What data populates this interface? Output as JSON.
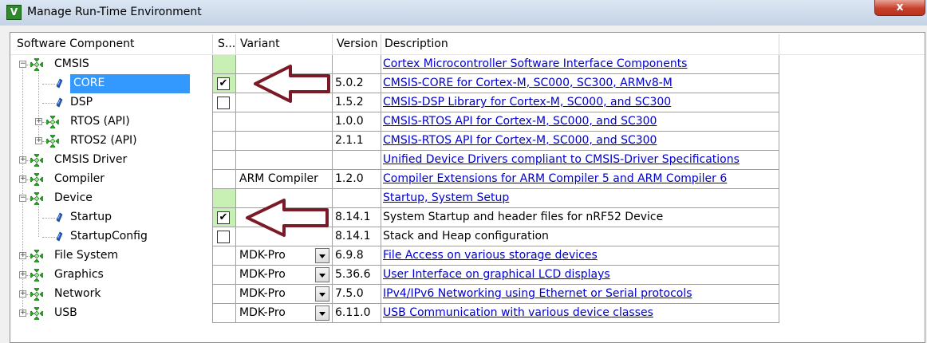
{
  "window": {
    "title": "Manage Run-Time Environment",
    "close_glyph": "x",
    "icon": "keil-app-icon"
  },
  "columns": {
    "component": "Software Component",
    "sel": "S...",
    "variant": "Variant",
    "version": "Version",
    "description": "Description"
  },
  "rows": [
    {
      "name": "CMSIS",
      "level": 0,
      "node": "expanded",
      "icon": "component-group-icon",
      "sel": "none",
      "sel_green": true,
      "variant": "",
      "version": "",
      "description": "Cortex Microcontroller Software Interface Components",
      "link": true
    },
    {
      "name": "CORE",
      "level": 1,
      "node": "leaf",
      "icon": "component-leaf-icon",
      "selected": true,
      "sel": "checked",
      "sel_green": true,
      "variant": "",
      "version": "5.0.2",
      "description": "CMSIS-CORE for Cortex-M, SC000, SC300, ARMv8-M",
      "link": true
    },
    {
      "name": "DSP",
      "level": 1,
      "node": "leaf",
      "icon": "component-leaf-icon",
      "sel": "unchecked",
      "variant": "",
      "version": "1.5.2",
      "description": "CMSIS-DSP Library for Cortex-M, SC000, and SC300",
      "link": true
    },
    {
      "name": "RTOS (API)",
      "level": 1,
      "node": "collapsed",
      "icon": "component-group-icon",
      "sel": "none",
      "variant": "",
      "version": "1.0.0",
      "description": "CMSIS-RTOS API for Cortex-M, SC000, and SC300",
      "link": true
    },
    {
      "name": "RTOS2 (API)",
      "level": 1,
      "node": "collapsed",
      "icon": "component-group-icon",
      "sel": "none",
      "variant": "",
      "version": "2.1.1",
      "description": "CMSIS-RTOS API for Cortex-M, SC000, and SC300",
      "link": true
    },
    {
      "name": "CMSIS Driver",
      "level": 0,
      "node": "collapsed",
      "icon": "component-group-icon",
      "sel": "none",
      "variant": "",
      "version": "",
      "description": "Unified Device Drivers compliant to CMSIS-Driver Specifications",
      "link": true
    },
    {
      "name": "Compiler",
      "level": 0,
      "node": "collapsed",
      "icon": "component-group-icon",
      "sel": "none",
      "variant": "ARM Compiler",
      "version": "1.2.0",
      "description": "Compiler Extensions for ARM Compiler 5 and ARM Compiler 6",
      "link": true
    },
    {
      "name": "Device",
      "level": 0,
      "node": "expanded",
      "icon": "component-group-icon",
      "sel": "none",
      "sel_green": true,
      "variant": "",
      "version": "",
      "description": "Startup, System Setup",
      "link": true
    },
    {
      "name": "Startup",
      "level": 1,
      "node": "leaf",
      "icon": "component-leaf-icon",
      "sel": "checked",
      "sel_green": true,
      "variant": "",
      "version": "8.14.1",
      "description": "System Startup and header files for nRF52 Device",
      "link": false
    },
    {
      "name": "StartupConfig",
      "level": 1,
      "node": "leaf",
      "icon": "component-leaf-icon",
      "sel": "unchecked",
      "variant": "",
      "version": "8.14.1",
      "description": "Stack and Heap configuration",
      "link": false
    },
    {
      "name": "File System",
      "level": 0,
      "node": "collapsed",
      "icon": "component-group-icon",
      "sel": "none",
      "variant": "MDK-Pro",
      "dropdown": true,
      "version": "6.9.8",
      "description": "File Access on various storage devices",
      "link": true
    },
    {
      "name": "Graphics",
      "level": 0,
      "node": "collapsed",
      "icon": "component-group-icon",
      "sel": "none",
      "variant": "MDK-Pro",
      "dropdown": true,
      "version": "5.36.6",
      "description": "User Interface on graphical LCD displays",
      "link": true
    },
    {
      "name": "Network",
      "level": 0,
      "node": "collapsed",
      "icon": "component-group-icon",
      "sel": "none",
      "variant": "MDK-Pro",
      "dropdown": true,
      "version": "7.5.0",
      "description": "IPv4/IPv6 Networking using Ethernet or Serial protocols",
      "link": true
    },
    {
      "name": "USB",
      "level": 0,
      "node": "collapsed",
      "icon": "component-group-icon",
      "sel": "none",
      "variant": "MDK-Pro",
      "dropdown": true,
      "version": "6.11.0",
      "description": "USB Communication with various device classes",
      "link": true
    }
  ],
  "annotations": [
    {
      "name": "arrow-to-core-checkbox",
      "points_at": "CORE",
      "color": "#7b1a26"
    },
    {
      "name": "arrow-to-startup-checkbox",
      "points_at": "Startup",
      "color": "#7b1a26"
    }
  ],
  "colors": {
    "link": "#0000cc",
    "selection": "#3399ff",
    "selectable_green": "#c8f0b4",
    "arrow": "#7b1a26",
    "gem_green": "#22a822"
  }
}
